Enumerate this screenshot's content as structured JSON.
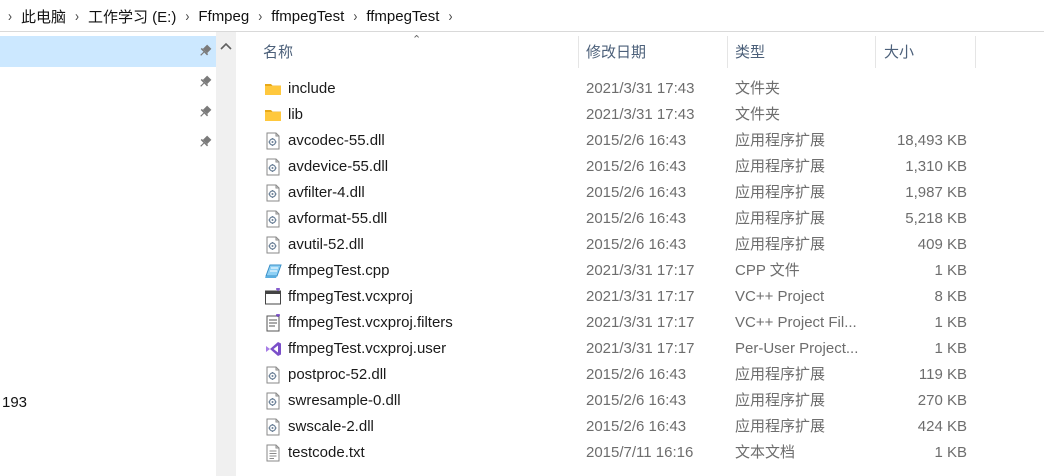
{
  "breadcrumb": [
    "此电脑",
    "工作学习 (E:)",
    "Ffmpeg",
    "ffmpegTest",
    "ffmpegTest"
  ],
  "nav": {
    "partial_label": "193"
  },
  "columns": {
    "name": "名称",
    "date": "修改日期",
    "type": "类型",
    "size": "大小"
  },
  "files": [
    {
      "name": "include",
      "date": "2021/3/31 17:43",
      "type": "文件夹",
      "size": "",
      "icon": "folder-icon"
    },
    {
      "name": "lib",
      "date": "2021/3/31 17:43",
      "type": "文件夹",
      "size": "",
      "icon": "folder-icon"
    },
    {
      "name": "avcodec-55.dll",
      "date": "2015/2/6 16:43",
      "type": "应用程序扩展",
      "size": "18,493 KB",
      "icon": "dll-file-icon"
    },
    {
      "name": "avdevice-55.dll",
      "date": "2015/2/6 16:43",
      "type": "应用程序扩展",
      "size": "1,310 KB",
      "icon": "dll-file-icon"
    },
    {
      "name": "avfilter-4.dll",
      "date": "2015/2/6 16:43",
      "type": "应用程序扩展",
      "size": "1,987 KB",
      "icon": "dll-file-icon"
    },
    {
      "name": "avformat-55.dll",
      "date": "2015/2/6 16:43",
      "type": "应用程序扩展",
      "size": "5,218 KB",
      "icon": "dll-file-icon"
    },
    {
      "name": "avutil-52.dll",
      "date": "2015/2/6 16:43",
      "type": "应用程序扩展",
      "size": "409 KB",
      "icon": "dll-file-icon"
    },
    {
      "name": "ffmpegTest.cpp",
      "date": "2021/3/31 17:17",
      "type": "CPP 文件",
      "size": "1 KB",
      "icon": "cpp-file-icon"
    },
    {
      "name": "ffmpegTest.vcxproj",
      "date": "2021/3/31 17:17",
      "type": "VC++ Project",
      "size": "8 KB",
      "icon": "vcxproj-file-icon"
    },
    {
      "name": "ffmpegTest.vcxproj.filters",
      "date": "2021/3/31 17:17",
      "type": "VC++ Project Fil...",
      "size": "1 KB",
      "icon": "filters-file-icon"
    },
    {
      "name": "ffmpegTest.vcxproj.user",
      "date": "2021/3/31 17:17",
      "type": "Per-User Project...",
      "size": "1 KB",
      "icon": "vs-user-file-icon"
    },
    {
      "name": "postproc-52.dll",
      "date": "2015/2/6 16:43",
      "type": "应用程序扩展",
      "size": "119 KB",
      "icon": "dll-file-icon"
    },
    {
      "name": "swresample-0.dll",
      "date": "2015/2/6 16:43",
      "type": "应用程序扩展",
      "size": "270 KB",
      "icon": "dll-file-icon"
    },
    {
      "name": "swscale-2.dll",
      "date": "2015/2/6 16:43",
      "type": "应用程序扩展",
      "size": "424 KB",
      "icon": "dll-file-icon"
    },
    {
      "name": "testcode.txt",
      "date": "2015/7/11 16:16",
      "type": "文本文档",
      "size": "1 KB",
      "icon": "text-file-icon"
    }
  ],
  "colors": {
    "selection": "#cce8ff",
    "header_text": "#4c607a",
    "folder": "#ffc83d"
  }
}
